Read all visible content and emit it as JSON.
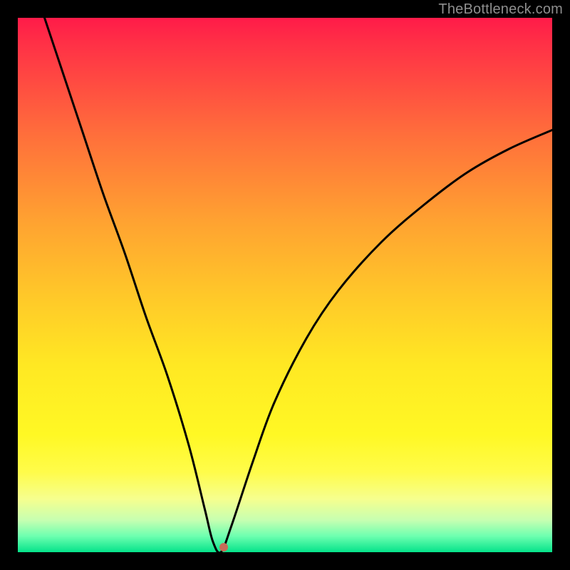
{
  "watermark": "TheBottleneck.com",
  "chart_data": {
    "type": "line",
    "title": "",
    "xlabel": "",
    "ylabel": "",
    "xlim": [
      0,
      100
    ],
    "ylim": [
      0,
      100
    ],
    "series": [
      {
        "name": "bottleneck-curve",
        "x": [
          5,
          8,
          12,
          16,
          20,
          24,
          28,
          32,
          35,
          36.5,
          38,
          40,
          44,
          48,
          54,
          60,
          68,
          76,
          84,
          92,
          100
        ],
        "values": [
          100,
          91,
          79,
          67,
          56,
          44,
          33,
          20,
          8,
          2,
          0,
          5,
          17,
          28,
          40,
          49,
          58,
          65,
          71,
          75.5,
          79
        ]
      }
    ],
    "marker": {
      "x": 38.5,
      "y": 1
    },
    "background_gradient": {
      "top": "#ff1b49",
      "mid": "#ffe823",
      "bottom": "#05e38a"
    }
  }
}
